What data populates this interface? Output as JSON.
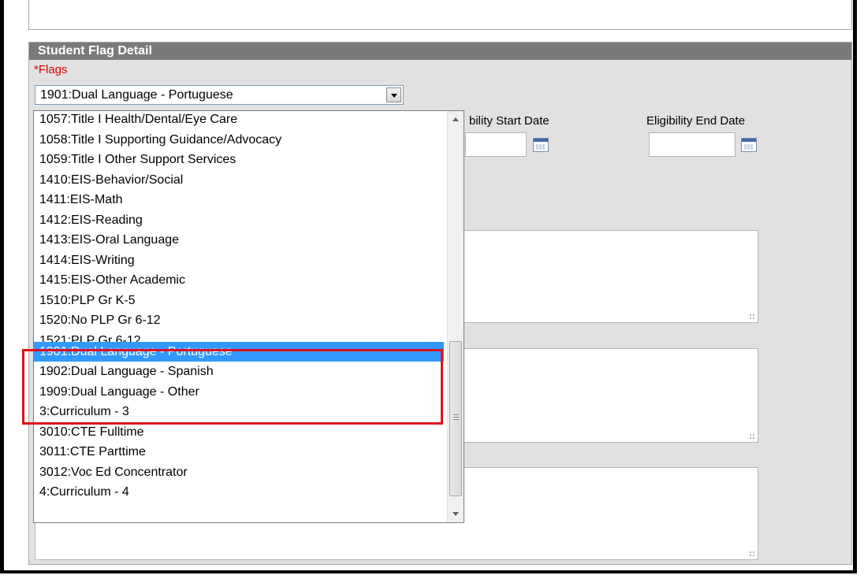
{
  "panel": {
    "header": "Student Flag Detail",
    "flags_label": "*Flags",
    "selected_value": "1901:Dual Language - Portuguese"
  },
  "fields": {
    "eligibility_start_label": "bility Start Date",
    "eligibility_end_label": "Eligibility End Date"
  },
  "dropdown": {
    "options": [
      "1057:Title I Health/Dental/Eye Care",
      "1058:Title I Supporting Guidance/Advocacy",
      "1059:Title I Other Support Services",
      "1410:EIS-Behavior/Social",
      "1411:EIS-Math",
      "1412:EIS-Reading",
      "1413:EIS-Oral Language",
      "1414:EIS-Writing",
      "1415:EIS-Other Academic",
      "1510:PLP Gr K-5",
      "1520:No PLP Gr 6-12",
      "1521:PLP Gr 6-12",
      "1901:Dual Language - Portuguese",
      "1902:Dual Language - Spanish",
      "1909:Dual Language - Other",
      "3:Curriculum - 3",
      "3010:CTE Fulltime",
      "3011:CTE Parttime",
      "3012:Voc Ed Concentrator",
      "4:Curriculum - 4"
    ],
    "selected_index": 12
  },
  "colors": {
    "header_bg": "#7a7a7a",
    "selection": "#3399ff",
    "required": "#e00000",
    "annotation": "#e0101a"
  }
}
